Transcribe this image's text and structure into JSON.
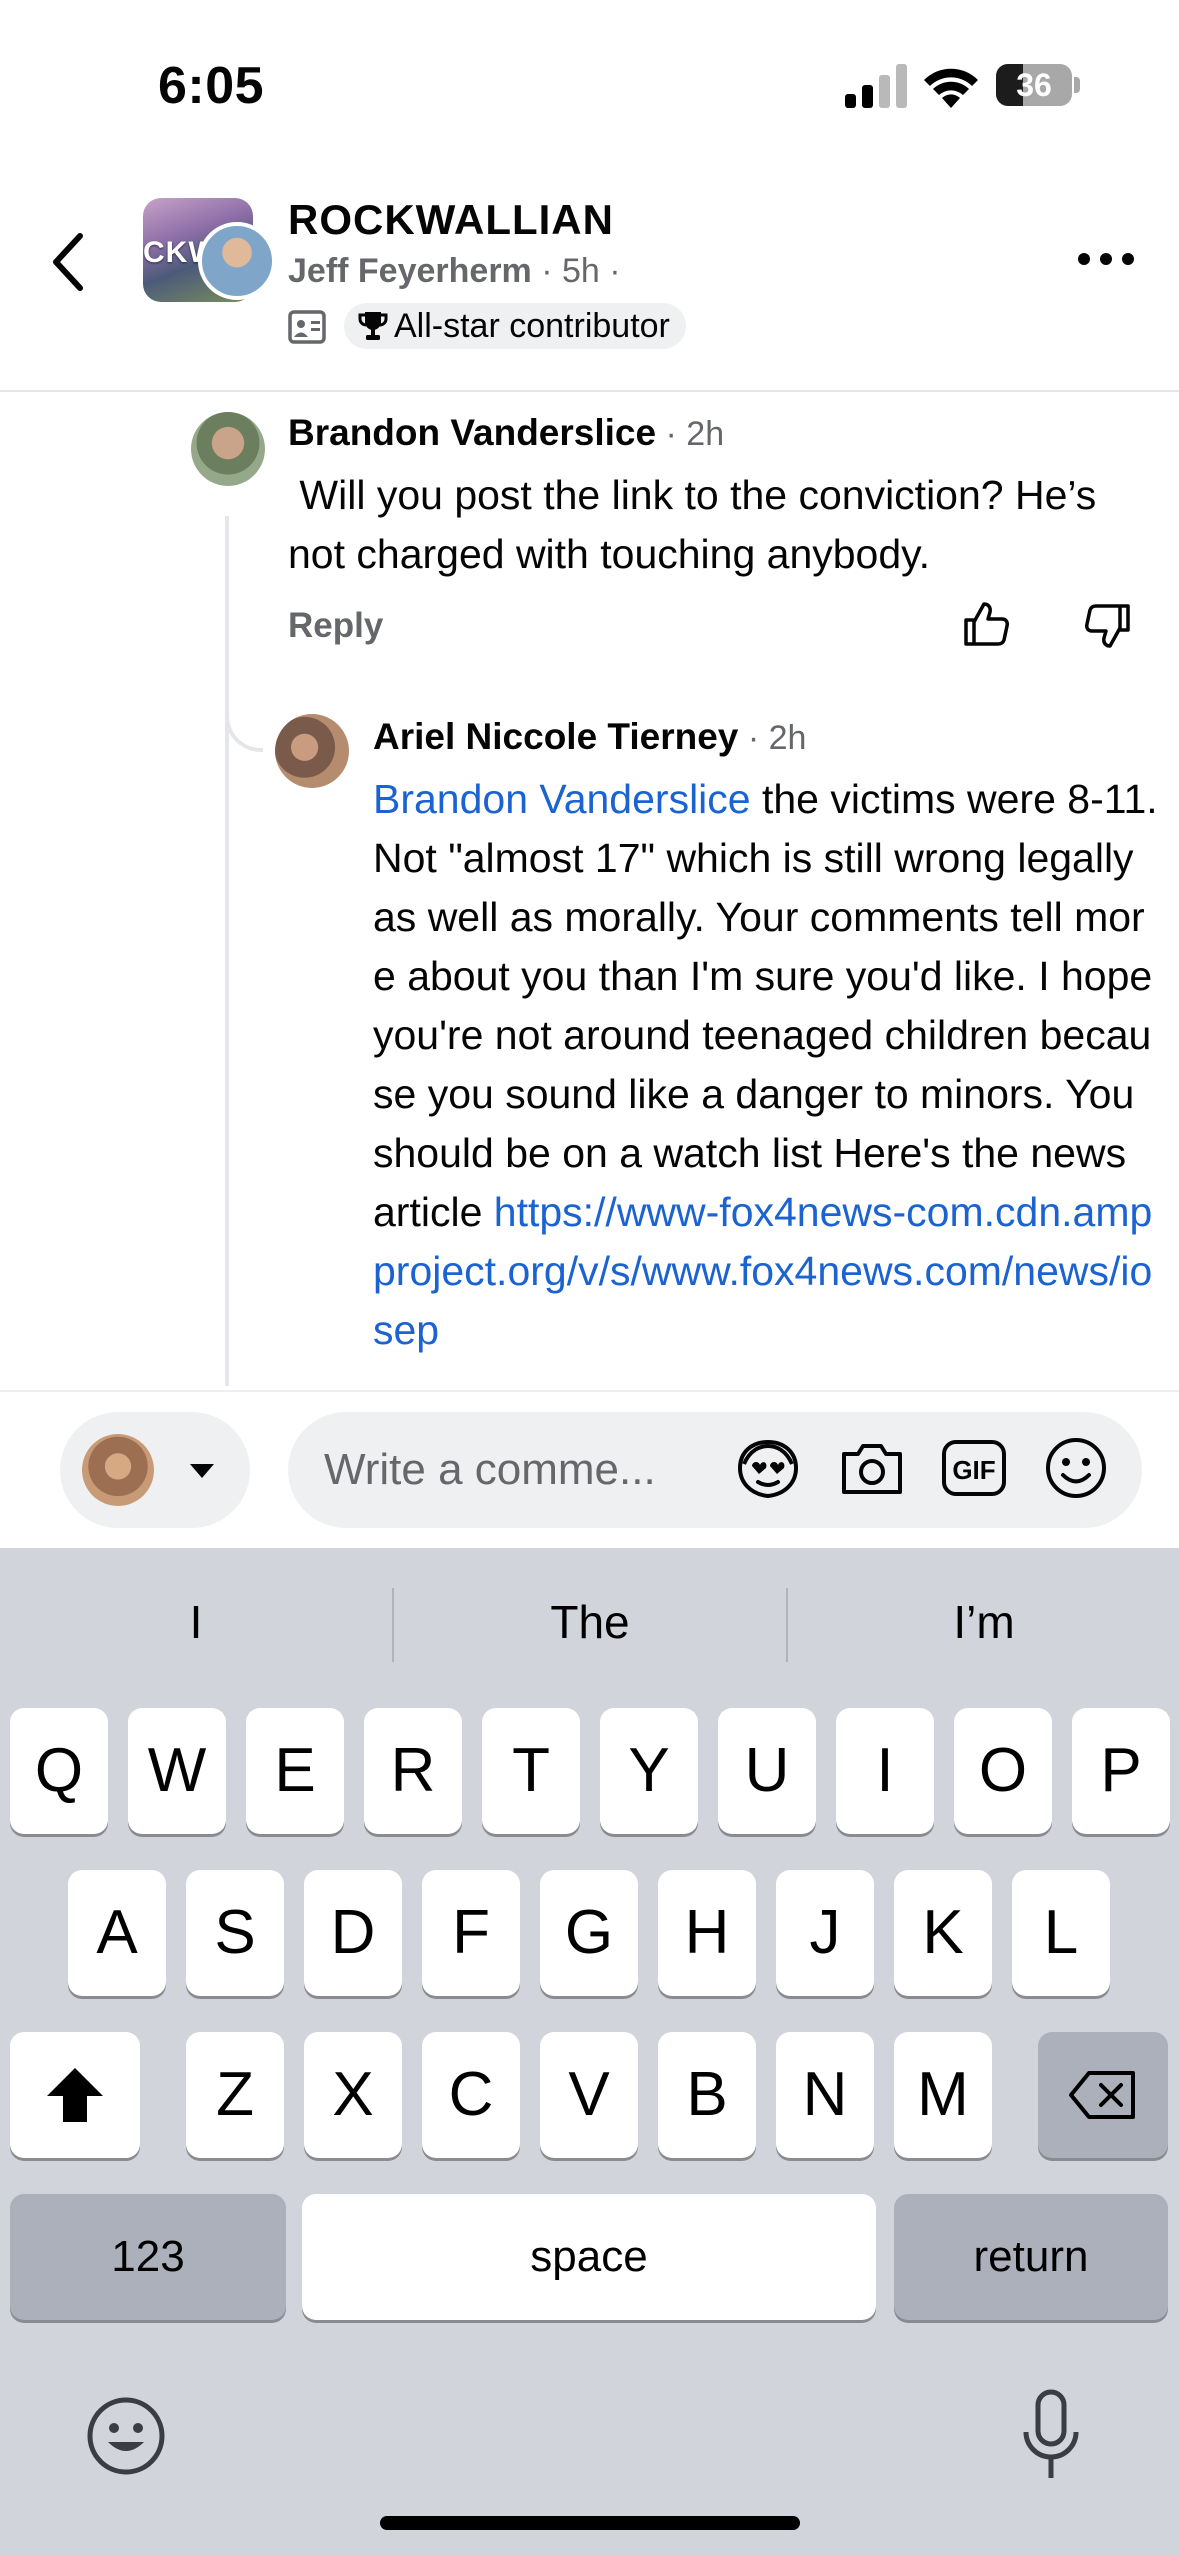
{
  "status_bar": {
    "time": "6:05",
    "battery_level": "36"
  },
  "header": {
    "group_name": "ROCKWALLIAN",
    "group_avatar_text": "CKWA",
    "author": "Jeff Feyerherm",
    "post_age": "5h",
    "badge": "All-star contributor"
  },
  "comments": [
    {
      "author": "Brandon Vanderslice",
      "time": "2h",
      "text": " Will you post the link to the conviction? He’s not charged with touching anybody.",
      "reply_label": "Reply"
    },
    {
      "author": "Ariel Niccole Tierney",
      "time": "2h",
      "mention": "Brandon Vanderslice",
      "text": " the victims were 8-11. Not \"almost 17\" which is still wrong legally as well as morally. Your comments tell more about you than I'm sure you'd like. I hope you're not around teenaged children because you sound like a danger to minors. You should be on a watch list Here's the news article ",
      "link": "https://www-fox4news-com.cdn.ampproject.org/v/s/www.fox4news.com/news/iosep"
    }
  ],
  "composer": {
    "placeholder": "Write a comme..."
  },
  "keyboard": {
    "suggestions": [
      "I",
      "The",
      "I’m"
    ],
    "row1": [
      "Q",
      "W",
      "E",
      "R",
      "T",
      "Y",
      "U",
      "I",
      "O",
      "P"
    ],
    "row2": [
      "A",
      "S",
      "D",
      "F",
      "G",
      "H",
      "J",
      "K",
      "L"
    ],
    "row3": [
      "Z",
      "X",
      "C",
      "V",
      "B",
      "N",
      "M"
    ],
    "numbers_label": "123",
    "space_label": "space",
    "return_label": "return"
  }
}
